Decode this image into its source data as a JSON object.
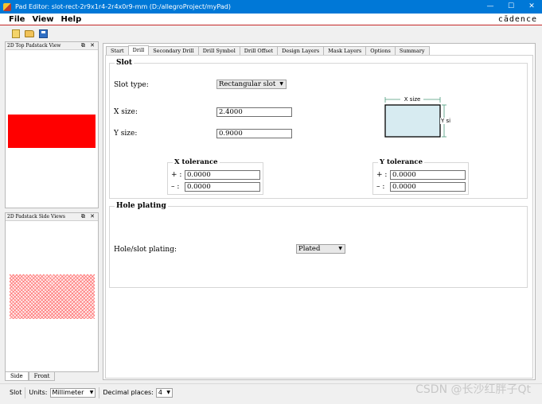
{
  "window": {
    "title": "Pad Editor: slot-rect-2r9x1r4-2r4x0r9-mm  (D:/allegroProject/myPad)",
    "minimize": "—",
    "maximize": "☐",
    "close": "✕"
  },
  "menu": {
    "file": "File",
    "view": "View",
    "help": "Help",
    "brand": "cādence"
  },
  "toolbar": {
    "icons": [
      "new-icon",
      "open-icon",
      "save-icon"
    ]
  },
  "left": {
    "top_view_title": "2D Top Padstack View",
    "side_view_title": "2D Padstack Side Views",
    "panel_buttons": "⧉ ✕",
    "side_tabs": [
      "Side",
      "Front"
    ]
  },
  "tabs": [
    "Start",
    "Drill",
    "Secondary Drill",
    "Drill Symbol",
    "Drill Offset",
    "Design Layers",
    "Mask Layers",
    "Options",
    "Summary"
  ],
  "slot": {
    "group_title": "Slot",
    "slot_type_label": "Slot type:",
    "slot_type_value": "Rectangular slot",
    "x_size_label": "X size:",
    "x_size_value": "2.4000",
    "y_size_label": "Y size:",
    "y_size_value": "0.9000",
    "diagram_x": "X size",
    "diagram_y": "Y size",
    "x_tol_title": "X tolerance",
    "y_tol_title": "Y tolerance",
    "plus": "+ :",
    "minus": "– :",
    "x_tol_plus": "0.0000",
    "x_tol_minus": "0.0000",
    "y_tol_plus": "0.0000",
    "y_tol_minus": "0.0000"
  },
  "plating": {
    "group_title": "Hole plating",
    "label": "Hole/slot plating:",
    "value": "Plated"
  },
  "status": {
    "mode": "Slot",
    "units_label": "Units:",
    "units_value": "Millimeter",
    "decimal_label": "Decimal places:",
    "decimal_value": "4"
  },
  "watermark": "CSDN @长沙红胖子Qt",
  "colors": {
    "titlebar": "#0078d7",
    "pad": "#ff0000",
    "slot_fill": "#d7ebf1"
  }
}
